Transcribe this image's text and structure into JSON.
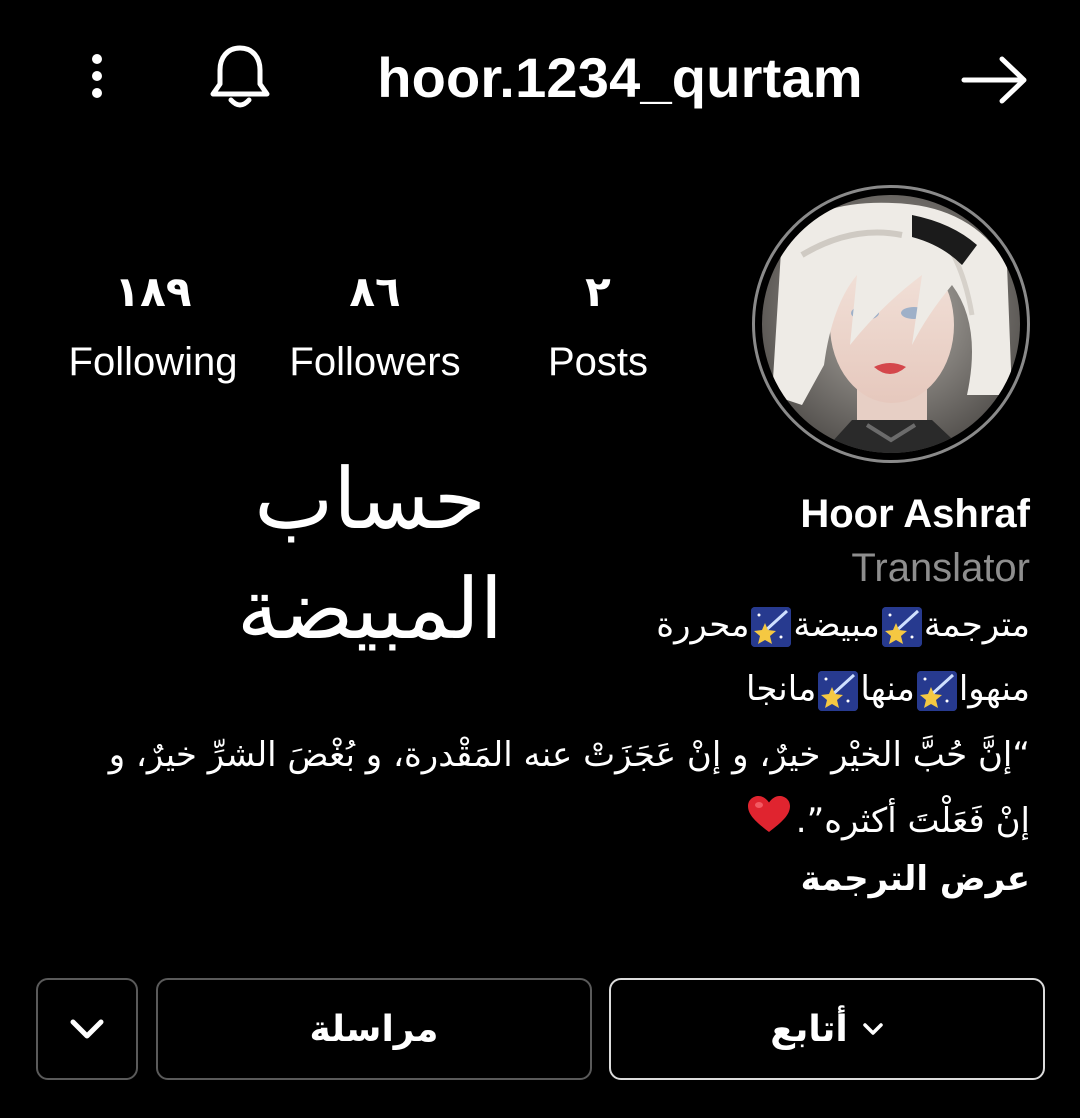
{
  "header": {
    "username": "hoor.1234_qurtam",
    "more_icon": "more-vertical-icon",
    "bell_icon": "bell-icon",
    "back_icon": "arrow-right-icon"
  },
  "profile": {
    "avatar_icon": "profile-avatar",
    "display_name": "Hoor Ashraf",
    "category": "Translator",
    "banner_text": "حساب المبيضة"
  },
  "stats": [
    {
      "value": "١٨٩",
      "label": "Following"
    },
    {
      "value": "٨٦",
      "label": "Followers"
    },
    {
      "value": "٢",
      "label": "Posts"
    }
  ],
  "bio": {
    "line1": [
      "مترجمة",
      "مبيضة",
      "محررة"
    ],
    "line2": [
      "منهوا",
      "منها",
      "مانجا"
    ],
    "line3": "“إنَّ حُبَّ الخيْر خيرٌ، و إنْ عَجَزَتْ عنه المَقْدرة، و بُغْضَ الشرِّ خيرٌ، و",
    "line4": "إنْ فَعَلْتَ أكثره”.",
    "see_translation": "عرض الترجمة",
    "star_icon": "shooting-star-emoji",
    "heart_icon": "red-heart-emoji"
  },
  "actions": {
    "follow_label": "أتابع",
    "message_label": "مراسلة",
    "expand_icon": "chevron-down-icon"
  },
  "colors": {
    "background": "#000000",
    "text": "#ffffff",
    "muted": "#8e8e8e",
    "heart": "#e0242f"
  }
}
